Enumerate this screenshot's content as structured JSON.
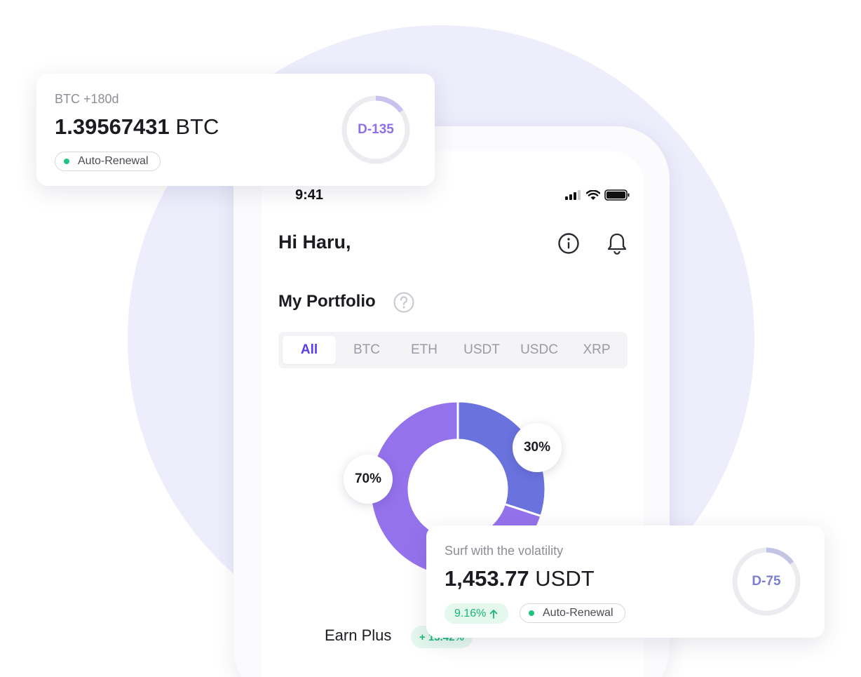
{
  "phone": {
    "status_time": "9:41",
    "greeting": "Hi Haru,",
    "portfolio_title": "My Portfolio",
    "tabs": [
      {
        "label": "All",
        "active": true
      },
      {
        "label": "BTC",
        "active": false
      },
      {
        "label": "ETH",
        "active": false
      },
      {
        "label": "USDT",
        "active": false
      },
      {
        "label": "USDC",
        "active": false
      },
      {
        "label": "XRP",
        "active": false
      }
    ],
    "donut": {
      "segments": [
        {
          "label": "30%",
          "value": 30,
          "color": "#6a72de"
        },
        {
          "label": "70%",
          "value": 70,
          "color": "#9472ec"
        }
      ]
    },
    "earn_label": "Earn Plus",
    "earn_badge": "+ 13.42%"
  },
  "card_top": {
    "caption": "BTC +180d",
    "amount": "1.39567431",
    "currency": "BTC",
    "pill": "Auto-Renewal",
    "ring_label": "D-135",
    "ring_progress": 0.15,
    "ring_color": "#8b72ea"
  },
  "card_bottom": {
    "caption": "Surf with the volatility",
    "amount": "1,453.77",
    "currency": "USDT",
    "return_badge": "9.16%",
    "pill": "Auto-Renewal",
    "ring_label": "D-75",
    "ring_progress": 0.15,
    "ring_color": "#7b7fd2"
  },
  "colors": {
    "accent": "#5a3df0",
    "green": "#1fc57f",
    "bg_circle": "#ededfc"
  }
}
